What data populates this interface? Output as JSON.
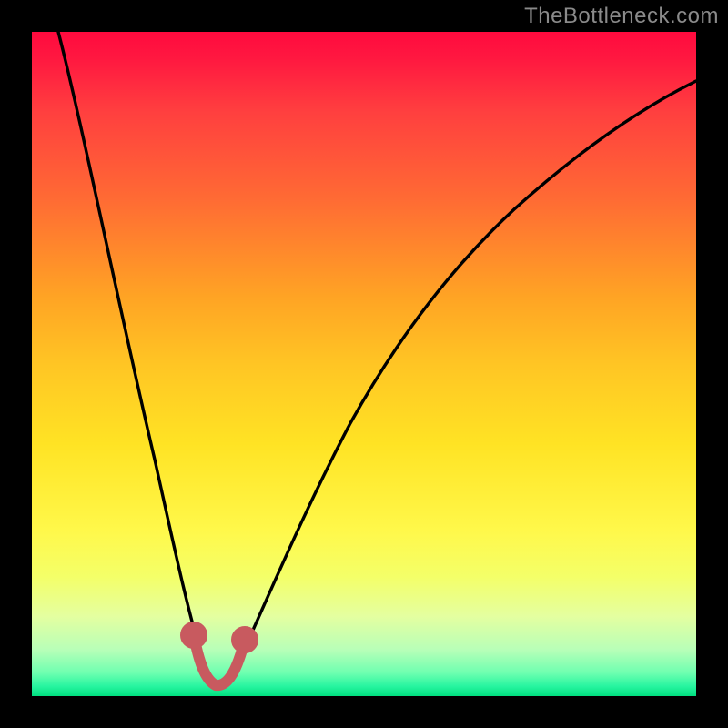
{
  "watermark": "TheBottleneck.com",
  "chart_data": {
    "type": "line",
    "title": "",
    "xlabel": "",
    "ylabel": "",
    "xlim": [
      0,
      100
    ],
    "ylim": [
      0,
      100
    ],
    "grid": false,
    "colors": {
      "gradient_top": "#ff0a3e",
      "gradient_mid": "#ffe324",
      "gradient_bottom": "#00e080",
      "curve": "#000000",
      "marker": "#c85a5f",
      "frame": "#000000"
    },
    "series": [
      {
        "name": "bottleneck-curve",
        "x": [
          4,
          6,
          8,
          10,
          12,
          14,
          16,
          18,
          20,
          22,
          24,
          26,
          28,
          30,
          32,
          36,
          40,
          46,
          52,
          60,
          68,
          76,
          84,
          92,
          100
        ],
        "values": [
          100,
          88,
          78,
          68,
          59,
          50,
          42,
          34,
          26,
          18,
          11,
          6,
          2.5,
          2.5,
          6,
          14,
          24,
          36,
          46,
          56,
          64,
          71,
          77,
          82,
          86
        ]
      }
    ],
    "markers": {
      "name": "optimal-region",
      "x": [
        24,
        25,
        26,
        27,
        28,
        29,
        30,
        31,
        32
      ],
      "values": [
        11,
        8,
        6,
        4.2,
        3,
        3,
        3.2,
        4.4,
        6.2
      ]
    },
    "minimum_x": 28
  }
}
